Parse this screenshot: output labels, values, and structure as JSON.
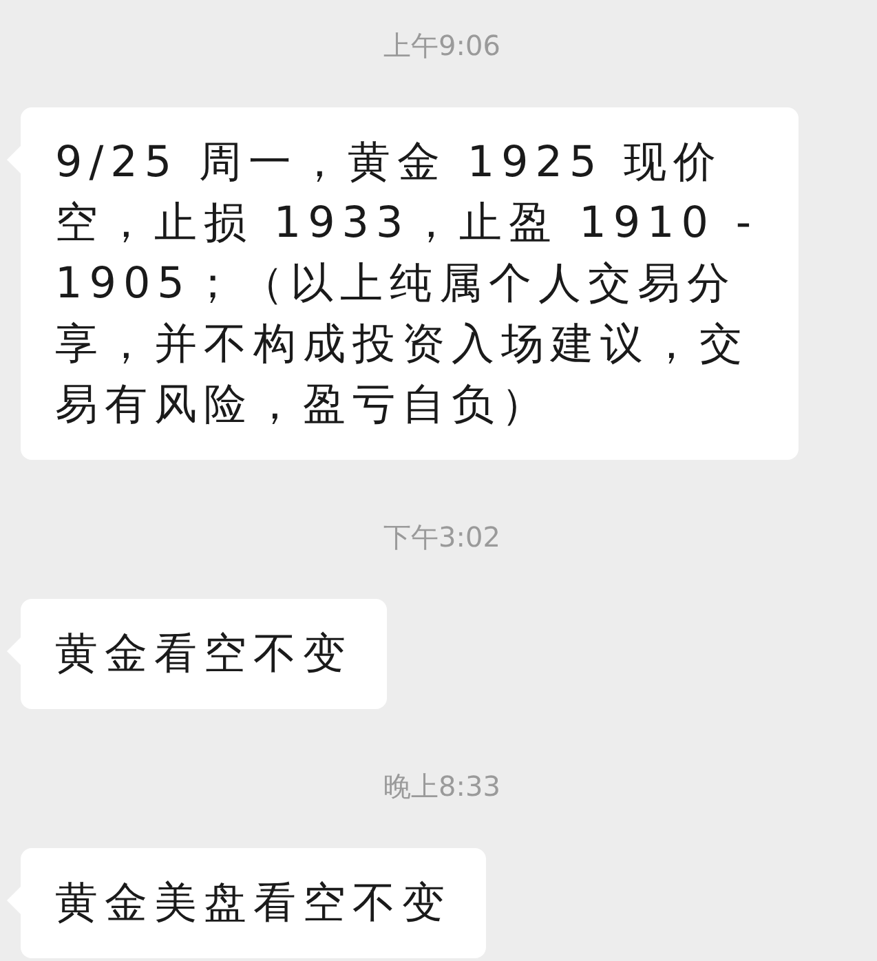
{
  "messages": [
    {
      "kind": "time",
      "text": "上午9:06"
    },
    {
      "kind": "bubble",
      "text": "9/25 周一，黄金 1925 现价空，止损 1933，止盈 1910 - 1905；（以上纯属个人交易分享，并不构成投资入场建议，交易有风险，盈亏自负）"
    },
    {
      "kind": "time",
      "text": "下午3:02"
    },
    {
      "kind": "bubble",
      "text": "黄金看空不变"
    },
    {
      "kind": "time",
      "text": "晚上8:33"
    },
    {
      "kind": "bubble",
      "text": "黄金美盘看空不变"
    }
  ]
}
